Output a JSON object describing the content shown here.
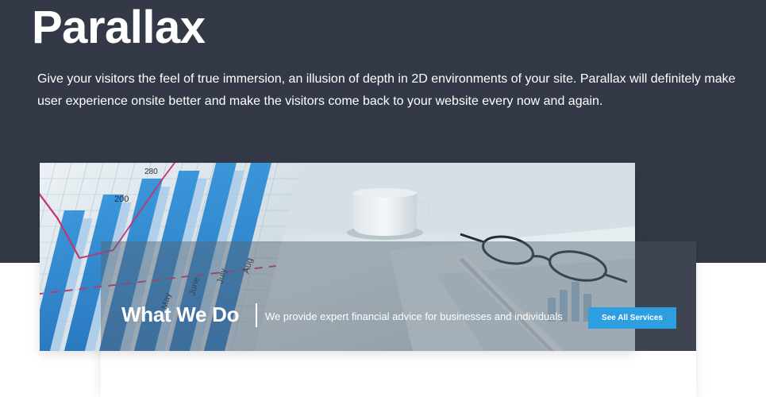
{
  "hero": {
    "title": "Parallax",
    "description": "Give your visitors the feel of true immersion, an illusion of depth in 2D environments of your site. Parallax will definitely make user experience onsite better and make the visitors come back to your website every now and again."
  },
  "photo": {
    "chart_labels": {
      "value_high": "280",
      "value_low": "200",
      "months": [
        "May",
        "June",
        "July",
        "Aug"
      ]
    }
  },
  "feature": {
    "title": "What We Do",
    "subtitle": "We provide expert financial advice for businesses and individuals",
    "button_label": "See All Services"
  },
  "colors": {
    "hero_bg": "#343948",
    "accent": "#2d9fe0",
    "text_light": "#ffffff"
  }
}
